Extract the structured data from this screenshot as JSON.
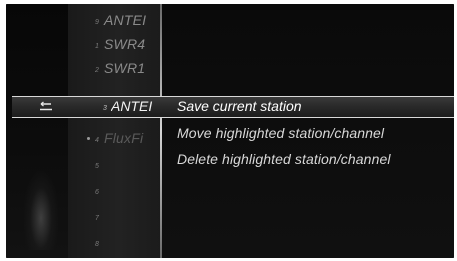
{
  "station_list": [
    {
      "num": "9",
      "name": "ANTEI",
      "dot": false,
      "dim": false
    },
    {
      "num": "1",
      "name": "SWR4",
      "dot": false,
      "dim": false
    },
    {
      "num": "2",
      "name": "SWR1",
      "dot": false,
      "dim": false
    },
    {
      "num": "3",
      "name": "ANTEI",
      "dot": false,
      "dim": false,
      "selected": true
    },
    {
      "num": "4",
      "name": "FluxFi",
      "dot": true,
      "dim": true
    },
    {
      "num": "5",
      "name": "",
      "dot": false,
      "dim": true
    },
    {
      "num": "6",
      "name": "",
      "dot": false,
      "dim": true
    },
    {
      "num": "7",
      "name": "",
      "dot": false,
      "dim": true
    },
    {
      "num": "8",
      "name": "",
      "dot": false,
      "dim": true
    }
  ],
  "menu": {
    "items": [
      "Save current station",
      "Move highlighted station/channel",
      "Delete highlighted station/channel"
    ]
  },
  "icons": {
    "back": "back-arrow-icon"
  },
  "colors": {
    "highlight_border": "#d9d9d9",
    "text": "#d8d8d8",
    "background": "#0b0b0b"
  }
}
